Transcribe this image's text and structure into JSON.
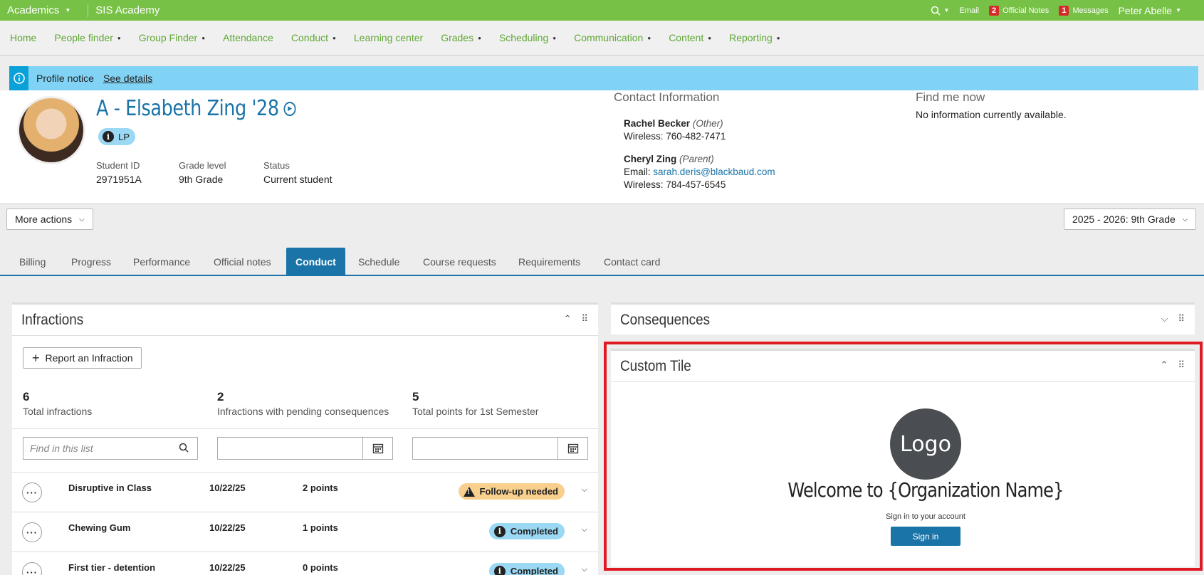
{
  "topbar": {
    "app_label": "Academics",
    "school": "SIS Academy",
    "email": "Email",
    "official_notes_count": "2",
    "official_notes": "Official Notes",
    "messages_count": "1",
    "messages": "Messages",
    "user": "Peter Abelle"
  },
  "nav": [
    "Home",
    "People finder",
    "Group Finder",
    "Attendance",
    "Conduct",
    "Learning center",
    "Grades",
    "Scheduling",
    "Communication",
    "Content",
    "Reporting"
  ],
  "notice": {
    "text": "Profile notice",
    "link": "See details"
  },
  "student": {
    "name": "A - Elsabeth Zing '28",
    "badge": "LP",
    "id_label": "Student ID",
    "id": "2971951A",
    "grade_label": "Grade level",
    "grade": "9th Grade",
    "status_label": "Status",
    "status": "Current student"
  },
  "contact": {
    "title": "Contact Information",
    "p1_name": "Rachel Becker",
    "p1_rel": "(Other)",
    "p1_line": "Wireless: 760-482-7471",
    "p2_name": "Cheryl Zing",
    "p2_rel": "(Parent)",
    "p2_email_label": "Email:",
    "p2_email": "sarah.deris@blackbaud.com",
    "p2_line": "Wireless: 784-457-6545"
  },
  "findme": {
    "title": "Find me now",
    "text": "No information currently available."
  },
  "actions": {
    "more": "More actions",
    "year": "2025 - 2026: 9th Grade"
  },
  "tabs": [
    "Billing",
    "Progress",
    "Performance",
    "Official notes",
    "Conduct",
    "Schedule",
    "Course requests",
    "Requirements",
    "Contact card"
  ],
  "infractions": {
    "title": "Infractions",
    "report_btn": "Report an Infraction",
    "stats": [
      {
        "n": "6",
        "l": "Total infractions"
      },
      {
        "n": "2",
        "l": "Infractions with pending consequences"
      },
      {
        "n": "5",
        "l": "Total points for 1st Semester"
      }
    ],
    "search_placeholder": "Find in this list",
    "rows": [
      {
        "name": "Disruptive in Class",
        "date": "10/22/25",
        "points": "2 points",
        "status": "Follow-up needed"
      },
      {
        "name": "Chewing Gum",
        "date": "10/22/25",
        "points": "1 points",
        "status": "Completed"
      },
      {
        "name": "First tier - detention",
        "date": "10/22/25",
        "points": "0 points",
        "status": "Completed"
      }
    ]
  },
  "consequences": {
    "title": "Consequences"
  },
  "custom_tile": {
    "title": "Custom Tile",
    "logo": "Logo",
    "welcome": "Welcome to {Organization Name}",
    "signin_label": "Sign in to your account",
    "signin_btn": "Sign in"
  },
  "colors": {
    "brand_green": "#77c146",
    "accent_blue": "#1a74a8",
    "highlight_red": "#e01a22"
  }
}
